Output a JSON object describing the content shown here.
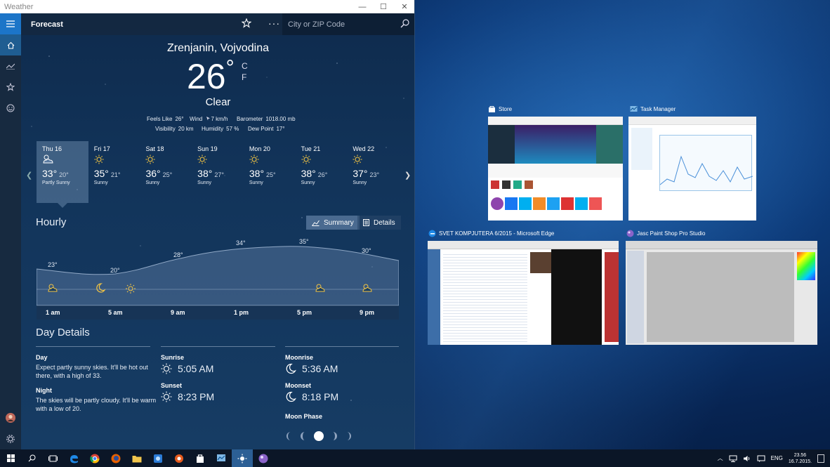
{
  "window": {
    "title": "Weather",
    "minimize": "—",
    "maximize": "☐",
    "close": "✕"
  },
  "topbar": {
    "title": "Forecast",
    "more_label": "···",
    "search_placeholder": "City or ZIP Code"
  },
  "current": {
    "location": "Zrenjanin, Vojvodina",
    "temperature": "26",
    "degree": "°",
    "unit_c": "C",
    "unit_f": "F",
    "condition": "Clear",
    "feels_like_label": "Feels Like",
    "feels_like": "26°",
    "wind_label": "Wind",
    "wind": "7 km/h",
    "barometer_label": "Barometer",
    "barometer": "1018.00 mb",
    "visibility_label": "Visibility",
    "visibility": "20 km",
    "humidity_label": "Humidity",
    "humidity": "57 %",
    "dew_point_label": "Dew Point",
    "dew_point": "17°"
  },
  "daily": [
    {
      "day": "Thu 16",
      "icon": "partly-sunny-icon",
      "hi": "33°",
      "lo": "20°",
      "cond": "Partly Sunny",
      "selected": true
    },
    {
      "day": "Fri 17",
      "icon": "sunny-icon",
      "hi": "35°",
      "lo": "21°",
      "cond": "Sunny"
    },
    {
      "day": "Sat 18",
      "icon": "sunny-icon",
      "hi": "36°",
      "lo": "25°",
      "cond": "Sunny"
    },
    {
      "day": "Sun 19",
      "icon": "sunny-icon",
      "hi": "38°",
      "lo": "27°",
      "cond": "Sunny"
    },
    {
      "day": "Mon 20",
      "icon": "sunny-icon",
      "hi": "38°",
      "lo": "25°",
      "cond": "Sunny"
    },
    {
      "day": "Tue 21",
      "icon": "sunny-icon",
      "hi": "38°",
      "lo": "26°",
      "cond": "Sunny"
    },
    {
      "day": "Wed 22",
      "icon": "sunny-icon",
      "hi": "37°",
      "lo": "23°",
      "cond": "Sunny"
    }
  ],
  "hourly": {
    "title": "Hourly",
    "summary_label": "Summary",
    "details_label": "Details",
    "temp_labels": [
      "23°",
      "20°",
      "28°",
      "34°",
      "35°",
      "30°"
    ],
    "time_labels": [
      "1 am",
      "5 am",
      "9 am",
      "1 pm",
      "5 pm",
      "9 pm"
    ],
    "icons": [
      "partly-cloudy-icon",
      "moon-icon",
      "sunny-icon",
      "partly-sunny-icon",
      "partly-sunny-icon"
    ]
  },
  "day_details": {
    "title": "Day Details",
    "day_label": "Day",
    "day_text": "Expect partly sunny skies. It'll be hot out there, with a high of 33.",
    "night_label": "Night",
    "night_text": "The skies will be partly cloudy. It'll be warm with a low of 20.",
    "sunrise_label": "Sunrise",
    "sunrise": "5:05 AM",
    "sunset_label": "Sunset",
    "sunset": "8:23 PM",
    "moonrise_label": "Moonrise",
    "moonrise": "5:36 AM",
    "moonset_label": "Moonset",
    "moonset": "8:18 PM",
    "moon_phase_label": "Moon Phase"
  },
  "task_view": {
    "store": "Store",
    "task_manager": "Task Manager",
    "edge": "SVET KOMPJUTERA 6/2015 - Microsoft Edge",
    "paint": "Jasc Paint Shop Pro Studio"
  },
  "tray": {
    "lang": "ENG",
    "time": "23.56",
    "date": "16.7.2015."
  },
  "colors": {
    "accent": "#1c75c8",
    "sidebar": "#172a40",
    "taskbar": "#0b1627"
  }
}
